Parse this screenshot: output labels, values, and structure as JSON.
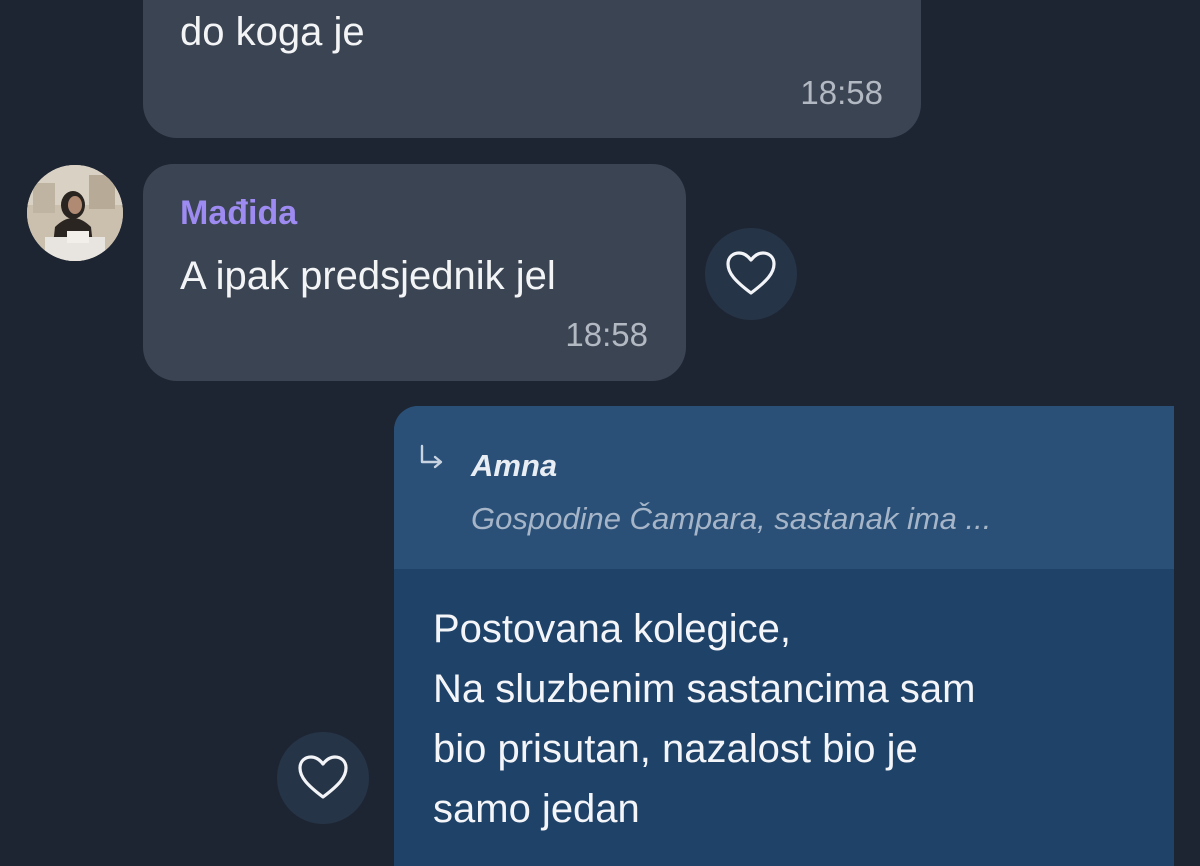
{
  "messages": [
    {
      "id": "msg1",
      "direction": "incoming",
      "text": "do koga je",
      "time": "18:58"
    },
    {
      "id": "msg2",
      "direction": "incoming",
      "sender": "Mađida",
      "text": "A ipak predsjednik jel",
      "time": "18:58",
      "avatar_icon": "user-avatar-photo",
      "like_icon": "heart-outline-icon"
    },
    {
      "id": "msg3",
      "direction": "outgoing",
      "reply_to": {
        "author": "Amna",
        "snippet": "Gospodine Čampara, sastanak ima ...",
        "icon": "reply-arrow-icon"
      },
      "lines": [
        "Postovana kolegice,",
        "Na sluzbenim sastancima sam",
        "bio prisutan, nazalost bio je",
        "samo jedan"
      ],
      "like_icon": "heart-outline-icon"
    }
  ],
  "colors": {
    "background": "#1d2533",
    "incoming_bubble": "#3b4452",
    "outgoing_bubble": "#1f4269",
    "reply_header": "#2a5077",
    "sender_name": "#9d8bf2"
  }
}
